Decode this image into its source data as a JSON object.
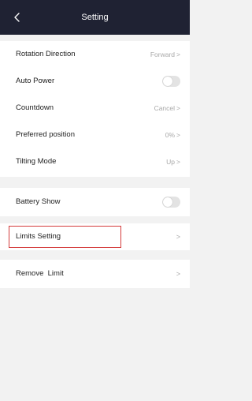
{
  "header": {
    "title": "Setting",
    "back_icon": "chevron-left-icon"
  },
  "group1": {
    "rotation_direction": {
      "label": "Rotation Direction",
      "value": "Forward"
    },
    "auto_power": {
      "label": "Auto Power",
      "on": false
    },
    "countdown": {
      "label": "Countdown",
      "value": "Cancel"
    },
    "preferred_position": {
      "label": "Preferred position",
      "value": "0%"
    },
    "tilting_mode": {
      "label": "Tilting Mode",
      "value": "Up"
    }
  },
  "group2": {
    "battery_show": {
      "label": "Battery Show",
      "on": false
    }
  },
  "group3": {
    "limits_setting": {
      "label": "Limits Setting"
    }
  },
  "group4": {
    "remove_limit": {
      "label": "Remove  Limit"
    }
  },
  "chevron": ">",
  "colors": {
    "header_bg": "#1f2233",
    "highlight": "#d43c3c",
    "value_text": "#a8a8a8"
  }
}
